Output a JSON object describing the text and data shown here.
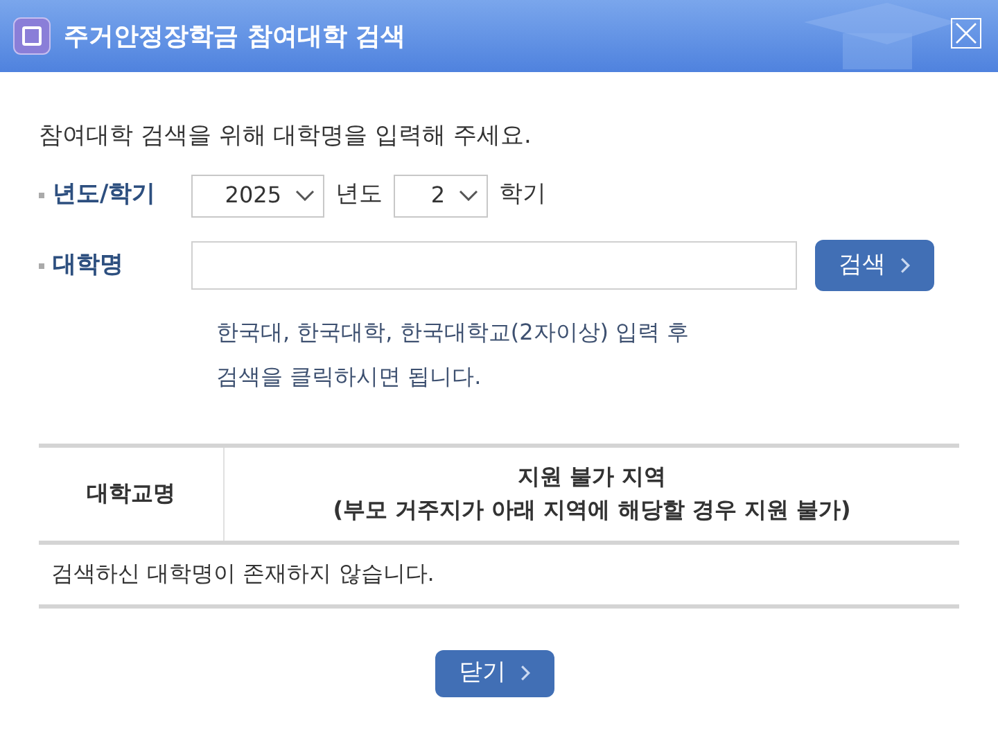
{
  "window": {
    "title": "주거안정장학금 참여대학 검색"
  },
  "intro": "참여대학 검색을 위해 대학명을 입력해 주세요.",
  "term": {
    "label": "년도/학기",
    "year": "2025",
    "year_unit": "년도",
    "semester": "2",
    "semester_unit": "학기"
  },
  "university": {
    "label": "대학명",
    "search_button": "검색"
  },
  "hint": [
    "한국대, 한국대학, 한국대학교(2자이상) 입력 후",
    "검색을 클릭하시면 됩니다."
  ],
  "table": {
    "columns": [
      {
        "lines": [
          "대학교명"
        ]
      },
      {
        "lines": [
          "지원 불가 지역",
          "(부모 거주지가 아래 지역에 해당할 경우 지원 불가)"
        ]
      }
    ],
    "empty_message": "검색하신 대학명이 존재하지 않습니다."
  },
  "close_button": "닫기"
}
